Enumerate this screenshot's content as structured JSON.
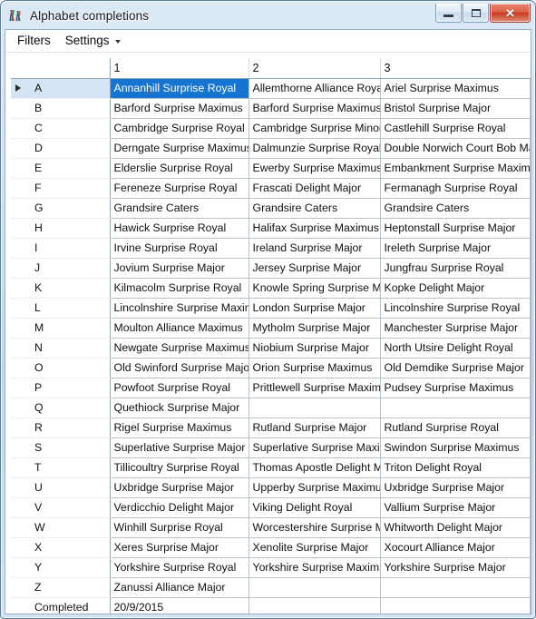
{
  "window": {
    "title": "Alphabet completions",
    "icon": "app-chart-icon",
    "controls": {
      "minimize": "minimize-button",
      "maximize": "maximize-button",
      "close": "✕"
    },
    "accent_selection": "#1675d1",
    "accent_row": "#d4e4f5",
    "close_button_color": "#c63c24"
  },
  "menubar": {
    "items": [
      {
        "label": "Filters",
        "has_caret": false
      },
      {
        "label": "Settings",
        "has_caret": true
      }
    ]
  },
  "grid": {
    "headers": [
      "",
      "1",
      "2",
      "3"
    ],
    "selected_row": 0,
    "selected_col": 1,
    "rows": [
      {
        "key": "A",
        "cells": [
          "Annanhill Surprise Royal",
          "Allemthorne Alliance Royal",
          "Ariel Surprise Maximus"
        ]
      },
      {
        "key": "B",
        "cells": [
          "Barford Surprise Maximus",
          "Barford Surprise Maximus",
          "Bristol Surprise Major"
        ]
      },
      {
        "key": "C",
        "cells": [
          "Cambridge Surprise Royal",
          "Cambridge Surprise Minor",
          "Castlehill Surprise Royal"
        ]
      },
      {
        "key": "D",
        "cells": [
          "Derngate Surprise Maximus",
          "Dalmunzie Surprise Royal",
          "Double Norwich Court Bob Major"
        ]
      },
      {
        "key": "E",
        "cells": [
          "Elderslie Surprise Royal",
          "Ewerby Surprise Maximus",
          "Embankment Surprise Maximus"
        ]
      },
      {
        "key": "F",
        "cells": [
          "Fereneze Surprise Royal",
          "Frascati Delight Major",
          "Fermanagh Surprise Royal"
        ]
      },
      {
        "key": "G",
        "cells": [
          "Grandsire Caters",
          "Grandsire Caters",
          "Grandsire Caters"
        ]
      },
      {
        "key": "H",
        "cells": [
          "Hawick Surprise Royal",
          "Halifax Surprise Maximus",
          "Heptonstall Surprise Major"
        ]
      },
      {
        "key": "I",
        "cells": [
          "Irvine Surprise Royal",
          "Ireland Surprise Major",
          "Ireleth Surprise Major"
        ]
      },
      {
        "key": "J",
        "cells": [
          "Jovium Surprise Major",
          "Jersey Surprise Major",
          "Jungfrau Surprise Royal"
        ]
      },
      {
        "key": "K",
        "cells": [
          "Kilmacolm Surprise Royal",
          "Knowle Spring Surprise Major",
          "Kopke Delight Major"
        ]
      },
      {
        "key": "L",
        "cells": [
          "Lincolnshire Surprise Maximus",
          "London Surprise Major",
          "Lincolnshire Surprise Royal"
        ]
      },
      {
        "key": "M",
        "cells": [
          "Moulton Alliance Maximus",
          "Mytholm Surprise Major",
          "Manchester Surprise Major"
        ]
      },
      {
        "key": "N",
        "cells": [
          "Newgate Surprise Maximus",
          "Niobium Surprise Major",
          "North Utsire Delight Royal"
        ]
      },
      {
        "key": "O",
        "cells": [
          "Old Swinford Surprise Major",
          "Orion Surprise Maximus",
          "Old Demdike Surprise Major"
        ]
      },
      {
        "key": "P",
        "cells": [
          "Powfoot Surprise Royal",
          "Prittlewell Surprise Maximus",
          "Pudsey Surprise Maximus"
        ]
      },
      {
        "key": "Q",
        "cells": [
          "Quethiock Surprise Major",
          "",
          ""
        ]
      },
      {
        "key": "R",
        "cells": [
          "Rigel Surprise Maximus",
          "Rutland Surprise Major",
          "Rutland Surprise Royal"
        ]
      },
      {
        "key": "S",
        "cells": [
          "Superlative Surprise Major",
          "Superlative Surprise Maximus",
          "Swindon Surprise Maximus"
        ]
      },
      {
        "key": "T",
        "cells": [
          "Tillicoultry Surprise Royal",
          "Thomas Apostle Delight Major",
          "Triton Delight Royal"
        ]
      },
      {
        "key": "U",
        "cells": [
          "Uxbridge Surprise Major",
          "Upperby Surprise Maximus",
          "Uxbridge Surprise Major"
        ]
      },
      {
        "key": "V",
        "cells": [
          "Verdicchio Delight Major",
          "Viking Delight Royal",
          "Vallium Surprise Major"
        ]
      },
      {
        "key": "W",
        "cells": [
          "Winhill Surprise Royal",
          "Worcestershire Surprise Major",
          "Whitworth Delight Major"
        ]
      },
      {
        "key": "X",
        "cells": [
          "Xeres Surprise Major",
          "Xenolite Surprise Major",
          "Xocourt Alliance Major"
        ]
      },
      {
        "key": "Y",
        "cells": [
          "Yorkshire Surprise Royal",
          "Yorkshire Surprise Maximus",
          "Yorkshire Surprise Major"
        ]
      },
      {
        "key": "Z",
        "cells": [
          "Zanussi Alliance Major",
          "",
          ""
        ]
      },
      {
        "key": "Completed",
        "cells": [
          "20/9/2015",
          "",
          ""
        ],
        "numeric": true
      }
    ]
  }
}
